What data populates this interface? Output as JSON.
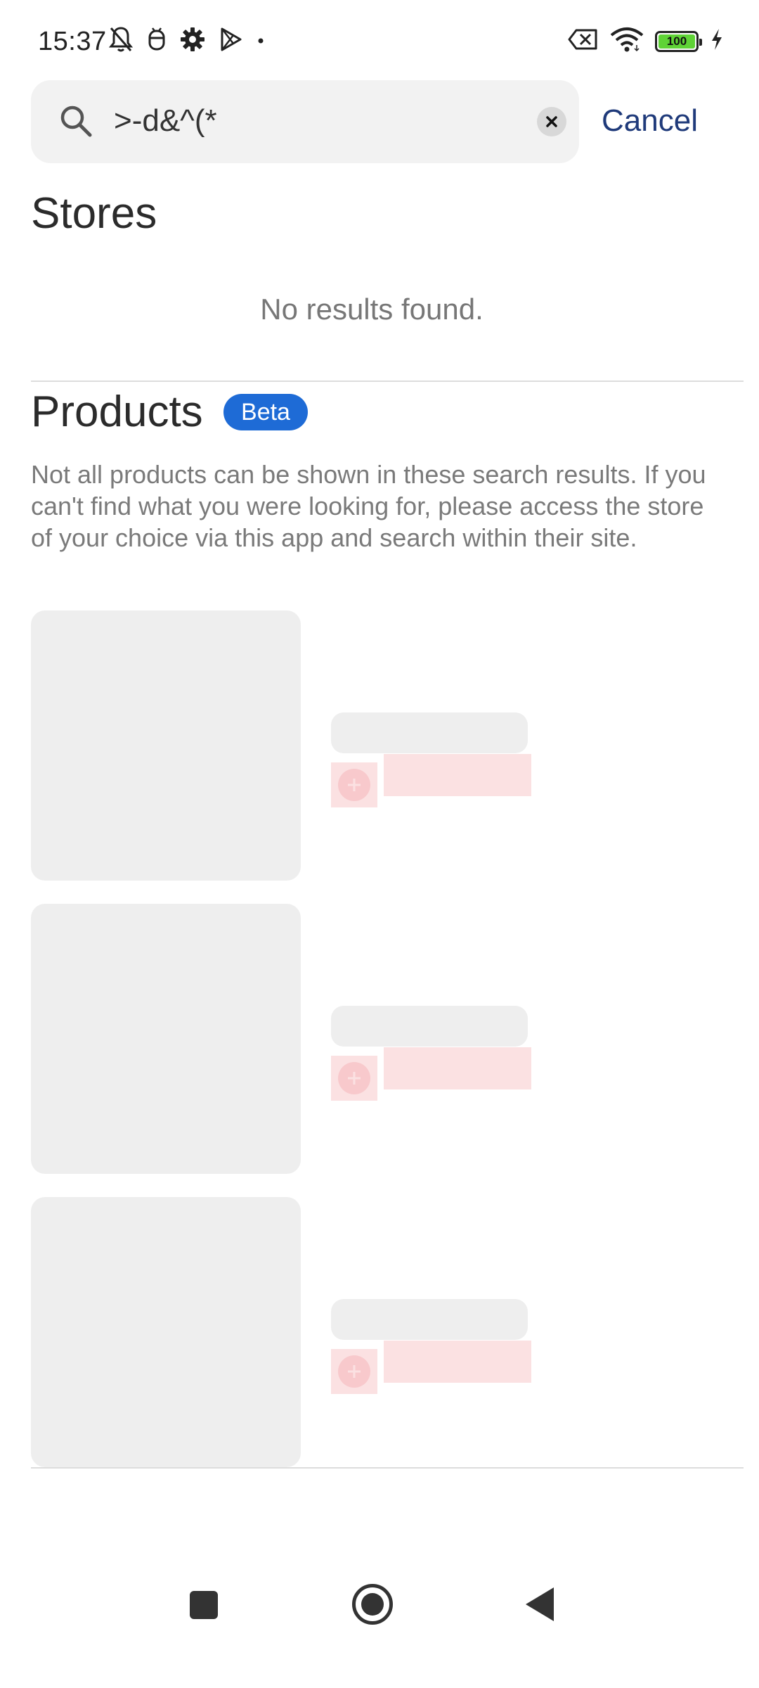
{
  "status_bar": {
    "time": "15:37",
    "battery_level": "100",
    "icons_left": [
      "bell-off-icon",
      "app-notification-icon",
      "gear-icon",
      "play-store-icon",
      "dot-icon"
    ],
    "icons_right": [
      "no-sim-icon",
      "wifi-icon",
      "battery-icon",
      "charging-icon"
    ]
  },
  "search": {
    "query": ">-d&^(*",
    "cancel_label": "Cancel"
  },
  "stores": {
    "title": "Stores",
    "empty_message": "No results found."
  },
  "products": {
    "title": "Products",
    "badge": "Beta",
    "note": "Not all products can be shown in these search results. If you can't find what you were looking for, please access the store of your choice via this app and search within their site.",
    "placeholder_cards": 3
  },
  "colors": {
    "accent_blue": "#1e6bd6",
    "cancel_text": "#1f3a7a",
    "skeleton_gray": "#eeeeee",
    "skeleton_pink": "#fbe1e2"
  }
}
